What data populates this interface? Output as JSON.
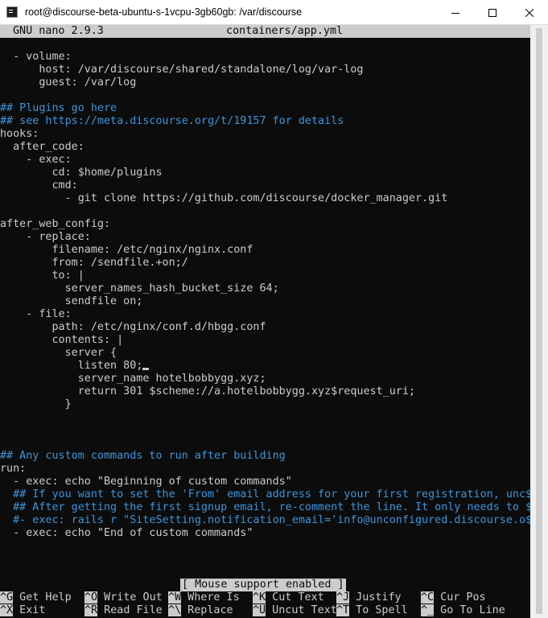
{
  "window": {
    "title": "root@discourse-beta-ubuntu-s-1vcpu-3gb60gb: /var/discourse"
  },
  "nano": {
    "version": "GNU nano 2.9.3",
    "filename": "containers/app.yml",
    "status_message": "[ Mouse support enabled ]"
  },
  "editor": {
    "lines": [
      {
        "text": "",
        "color": "white"
      },
      {
        "text": "  - volume:",
        "color": "white"
      },
      {
        "text": "      host: /var/discourse/shared/standalone/log/var-log",
        "color": "white"
      },
      {
        "text": "      guest: /var/log",
        "color": "white"
      },
      {
        "text": "",
        "color": "white"
      },
      {
        "text": "## Plugins go here",
        "color": "cyan"
      },
      {
        "text": "## see https://meta.discourse.org/t/19157 for details",
        "color": "cyan"
      },
      {
        "text": "hooks:",
        "color": "white"
      },
      {
        "text": "  after_code:",
        "color": "white"
      },
      {
        "text": "    - exec:",
        "color": "white"
      },
      {
        "text": "        cd: $home/plugins",
        "color": "white"
      },
      {
        "text": "        cmd:",
        "color": "white"
      },
      {
        "text": "          - git clone https://github.com/discourse/docker_manager.git",
        "color": "white"
      },
      {
        "text": "",
        "color": "white"
      },
      {
        "text": "after_web_config:",
        "color": "white"
      },
      {
        "text": "    - replace:",
        "color": "white"
      },
      {
        "text": "        filename: /etc/nginx/nginx.conf",
        "color": "white"
      },
      {
        "text": "        from: /sendfile.+on;/",
        "color": "white"
      },
      {
        "text": "        to: |",
        "color": "white"
      },
      {
        "text": "          server_names_hash_bucket_size 64;",
        "color": "white"
      },
      {
        "text": "          sendfile on;",
        "color": "white"
      },
      {
        "text": "    - file:",
        "color": "white"
      },
      {
        "text": "        path: /etc/nginx/conf.d/hbgg.conf",
        "color": "white"
      },
      {
        "text": "        contents: |",
        "color": "white"
      },
      {
        "text": "          server {",
        "color": "white"
      },
      {
        "text": "            listen 80;",
        "color": "white",
        "cursor": true
      },
      {
        "text": "            server_name hotelbobbygg.xyz;",
        "color": "white"
      },
      {
        "text": "            return 301 $scheme://a.hotelbobbygg.xyz$request_uri;",
        "color": "white"
      },
      {
        "text": "          }",
        "color": "white"
      },
      {
        "text": "",
        "color": "white"
      },
      {
        "text": "",
        "color": "white"
      },
      {
        "text": "",
        "color": "white"
      },
      {
        "text": "## Any custom commands to run after building",
        "color": "cyan"
      },
      {
        "text": "run:",
        "color": "white"
      },
      {
        "text": "  - exec: echo \"Beginning of custom commands\"",
        "color": "white"
      },
      {
        "text": "  ## If you want to set the 'From' email address for your first registration, unc$",
        "color": "cyan"
      },
      {
        "text": "  ## After getting the first signup email, re-comment the line. It only needs to $",
        "color": "cyan"
      },
      {
        "text": "  #- exec: rails r \"SiteSetting.notification_email='info@unconfigured.discourse.o$",
        "color": "cyan"
      },
      {
        "text": "  - exec: echo \"End of custom commands\"",
        "color": "white"
      }
    ]
  },
  "shortcuts": [
    {
      "key": "^G",
      "label": " Get Help  "
    },
    {
      "key": "^O",
      "label": " Write Out "
    },
    {
      "key": "^W",
      "label": " Where Is  "
    },
    {
      "key": "^K",
      "label": " Cut Text  "
    },
    {
      "key": "^J",
      "label": " Justify   "
    },
    {
      "key": "^C",
      "label": " Cur Pos"
    },
    {
      "key": "^X",
      "label": " Exit      "
    },
    {
      "key": "^R",
      "label": " Read File "
    },
    {
      "key": "^\\",
      "label": " Replace   "
    },
    {
      "key": "^U",
      "label": " Uncut Text"
    },
    {
      "key": "^T",
      "label": " To Spell  "
    },
    {
      "key": "^_",
      "label": " Go To Line"
    }
  ],
  "colors": {
    "foreground": "#cccccc",
    "comment": "#3a96dd",
    "background": "#0c0c0c"
  }
}
